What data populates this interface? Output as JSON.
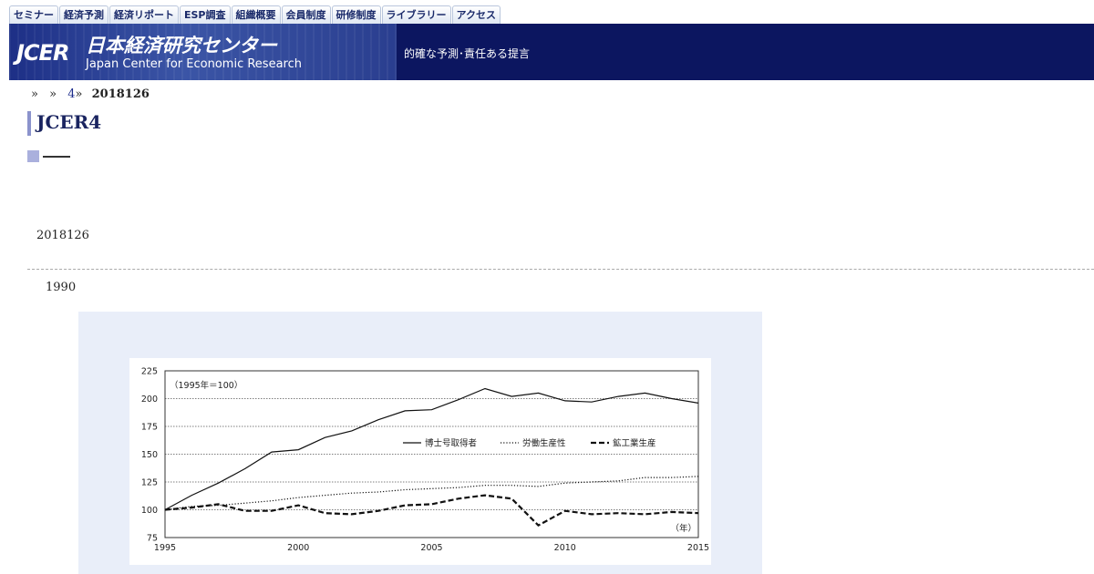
{
  "nav": {
    "tabs": [
      "セミナー",
      "経済予測",
      "経済リポート",
      "ESP調査",
      "組織概要",
      "会員制度",
      "研修制度",
      "ライブラリー",
      "アクセス"
    ]
  },
  "header": {
    "logo": "JCER",
    "jp_name": "日本経済研究センター",
    "en_name": "Japan Center for Economic Research",
    "tagline": "的確な予測･責任ある提言"
  },
  "breadcrumb": {
    "sep1": "»",
    "sep2": "»",
    "link": "4",
    "sep3": "»",
    "current": "2018126"
  },
  "page": {
    "title": "JCER4",
    "date": "2018126",
    "year": "1990"
  },
  "colors": {
    "banner": "#0c1660",
    "title": "#1a2460",
    "accent": "#8b93cc",
    "chart_bg": "#e9eef9"
  },
  "chart_data": {
    "type": "line",
    "annotation": "（1995年＝100）",
    "xlabel": "（年）",
    "ylim": [
      75,
      225
    ],
    "xlim": [
      1995,
      2015
    ],
    "yticks": [
      "75",
      "100",
      "125",
      "150",
      "175",
      "200",
      "225"
    ],
    "xticks": [
      "1995",
      "2000",
      "2005",
      "2010",
      "2015"
    ],
    "grid": "horizontal dotted",
    "legend_position": "top-right",
    "x": [
      1995,
      1996,
      1997,
      1998,
      1999,
      2000,
      2001,
      2002,
      2003,
      2004,
      2005,
      2006,
      2007,
      2008,
      2009,
      2010,
      2011,
      2012,
      2013,
      2014,
      2015
    ],
    "series": [
      {
        "name": "博士号取得者",
        "style": "solid",
        "values": [
          100,
          113,
          124,
          137,
          152,
          154,
          165,
          171,
          181,
          189,
          190,
          199,
          209,
          202,
          205,
          198,
          197,
          202,
          205,
          200,
          196
        ]
      },
      {
        "name": "労働生産性",
        "style": "dotted",
        "values": [
          100,
          103,
          104,
          106,
          108,
          111,
          113,
          115,
          116,
          118,
          119,
          120,
          122,
          122,
          121,
          124,
          125,
          126,
          129,
          129,
          130
        ]
      },
      {
        "name": "鉱工業生産",
        "style": "dashed",
        "values": [
          100,
          102,
          105,
          99,
          99,
          104,
          97,
          96,
          99,
          104,
          105,
          110,
          113,
          110,
          86,
          99,
          96,
          97,
          96,
          98,
          97
        ]
      }
    ]
  }
}
